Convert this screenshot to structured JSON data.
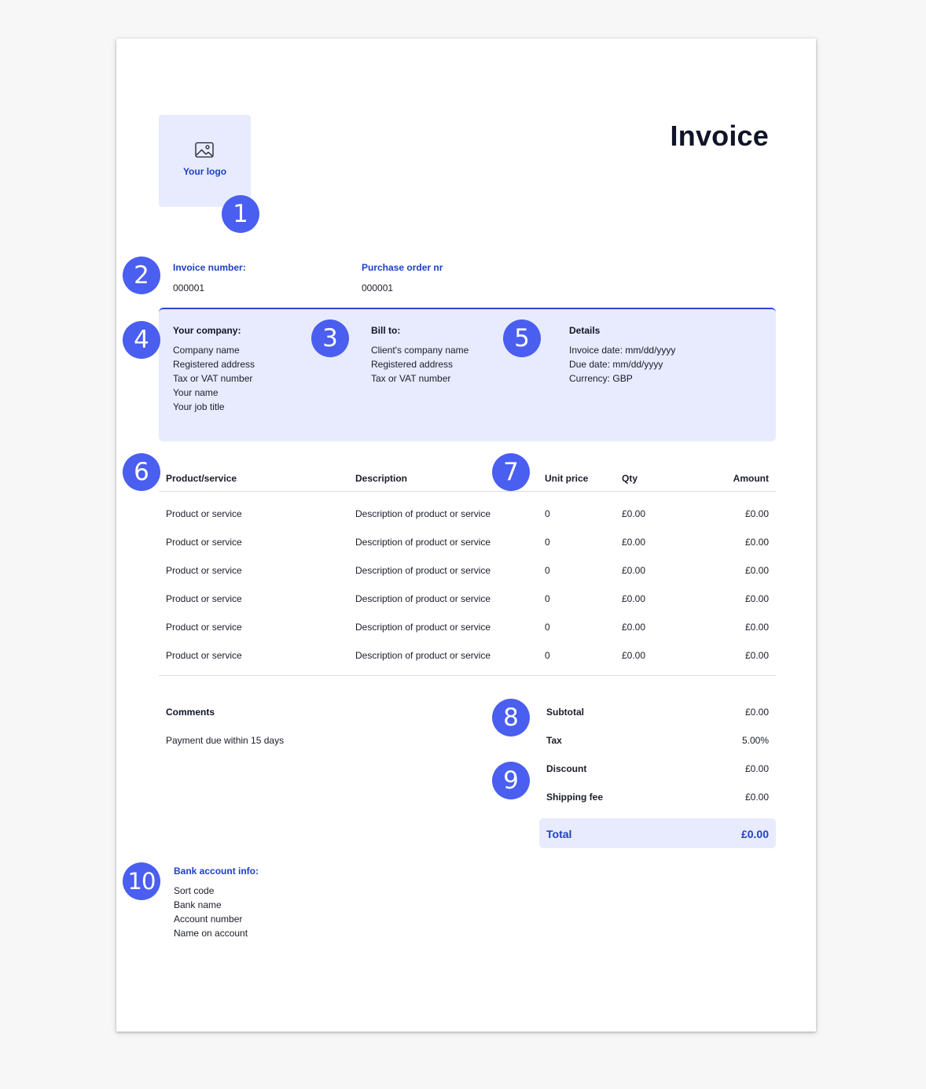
{
  "header": {
    "logo_label": "Your logo",
    "title": "Invoice"
  },
  "badges": [
    "1",
    "2",
    "3",
    "4",
    "5",
    "6",
    "7",
    "8",
    "9",
    "10"
  ],
  "invoice_meta": {
    "invoice_number_label": "Invoice number:",
    "invoice_number": "000001",
    "po_label": "Purchase order nr",
    "po_number": "000001"
  },
  "company": {
    "heading": "Your company:",
    "lines": [
      "Company name",
      "Registered address",
      "Tax or VAT number",
      "Your name",
      "Your job title"
    ]
  },
  "bill_to": {
    "heading": "Bill to:",
    "lines": [
      "Client's company name",
      "Registered address",
      "Tax or VAT number"
    ]
  },
  "details": {
    "heading": "Details",
    "invoice_date_label": "Invoice date:",
    "invoice_date": "mm/dd/yyyy",
    "due_date": "Due date: mm/dd/yyyy",
    "currency_label": "Currency:",
    "currency": "GBP"
  },
  "table": {
    "headers": {
      "product": "Product/service",
      "description": "Description",
      "unit_price": "Unit price",
      "qty": "Qty",
      "amount": "Amount"
    },
    "rows": [
      {
        "product": "Product or service",
        "description": "Description of product or service",
        "unit_price": "0",
        "qty": "£0.00",
        "amount": "£0.00"
      },
      {
        "product": "Product or service",
        "description": "Description of product or service",
        "unit_price": "0",
        "qty": "£0.00",
        "amount": "£0.00"
      },
      {
        "product": "Product or service",
        "description": "Description of product or service",
        "unit_price": "0",
        "qty": "£0.00",
        "amount": "£0.00"
      },
      {
        "product": "Product or service",
        "description": "Description of product or service",
        "unit_price": "0",
        "qty": "£0.00",
        "amount": "£0.00"
      },
      {
        "product": "Product or service",
        "description": "Description of product or service",
        "unit_price": "0",
        "qty": "£0.00",
        "amount": "£0.00"
      },
      {
        "product": "Product or service",
        "description": "Description of product or service",
        "unit_price": "0",
        "qty": "£0.00",
        "amount": "£0.00"
      }
    ]
  },
  "comments": {
    "heading": "Comments",
    "text": "Payment due within 15 days"
  },
  "totals": {
    "subtotal_label": "Subtotal",
    "subtotal": "£0.00",
    "tax_label": "Tax",
    "tax": "5.00%",
    "discount_label": "Discount",
    "discount": "£0.00",
    "shipping_label": "Shipping fee",
    "shipping": "£0.00",
    "total_label": "Total",
    "total": "£0.00"
  },
  "bank": {
    "heading": "Bank account info:",
    "lines": [
      "Sort code",
      "Bank name",
      "Account number",
      "Name on account"
    ]
  },
  "colors": {
    "accent": "#1e40c4",
    "badge": "#4a5ef0",
    "panel": "#e8ebfd"
  },
  "icons": {
    "logo": "image-icon"
  }
}
